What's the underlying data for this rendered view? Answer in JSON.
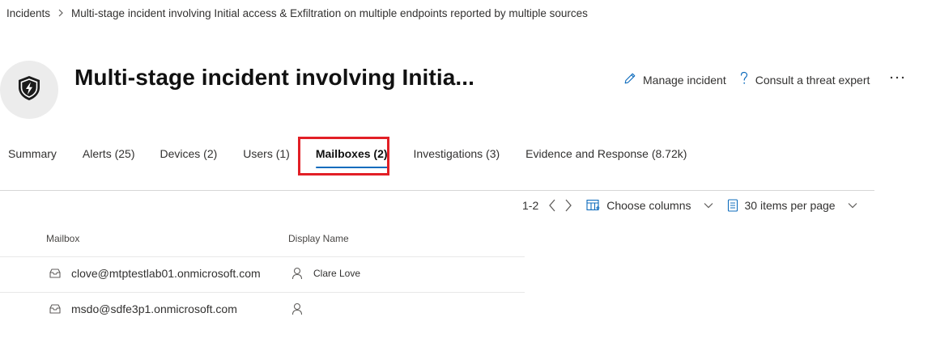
{
  "breadcrumb": {
    "root": "Incidents",
    "current": "Multi-stage incident involving Initial access & Exfiltration on multiple endpoints reported by multiple sources"
  },
  "header": {
    "title": "Multi-stage incident involving Initia...",
    "icon": "shield-lightning-icon",
    "actions": {
      "manage": "Manage incident",
      "consult": "Consult a threat expert"
    }
  },
  "tabs": [
    {
      "label": "Summary"
    },
    {
      "label": "Alerts (25)"
    },
    {
      "label": "Devices (2)"
    },
    {
      "label": "Users (1)"
    },
    {
      "label": "Mailboxes (2)",
      "active": true
    },
    {
      "label": "Investigations (3)"
    },
    {
      "label": "Evidence and Response (8.72k)"
    }
  ],
  "toolbar": {
    "range": "1-2",
    "choose_columns": "Choose columns",
    "items_per_page": "30 items per page"
  },
  "table": {
    "columns": [
      "Mailbox",
      "Display Name"
    ],
    "rows": [
      {
        "mailbox": "clove@mtptestlab01.onmicrosoft.com",
        "display_name": "Clare Love"
      },
      {
        "mailbox": "msdo@sdfe3p1.onmicrosoft.com",
        "display_name": ""
      }
    ]
  },
  "colors": {
    "highlight": "#e21f26",
    "active_tab_underline": "#0f6cbd",
    "link_icon": "#0f6cbd"
  }
}
